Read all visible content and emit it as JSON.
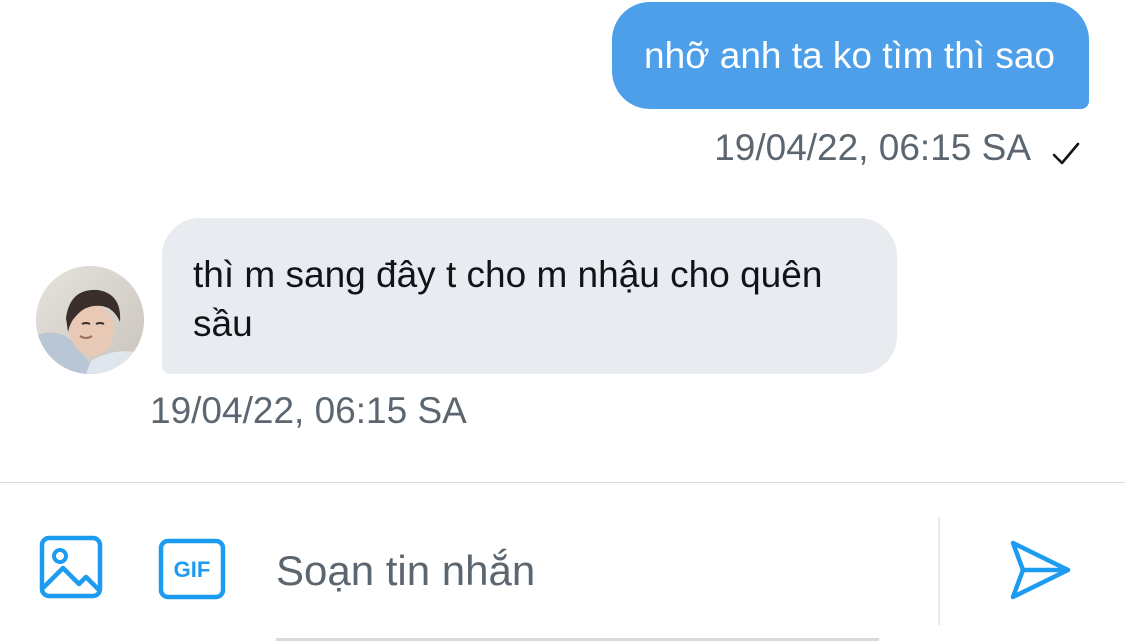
{
  "conversation": {
    "outgoing": {
      "text": "nhỡ anh ta ko tìm thì sao",
      "timestamp": "19/04/22, 06:15 SA",
      "status_icon": "check-icon"
    },
    "incoming": {
      "text": "thì m sang đây t cho m nhậu cho quên sầu",
      "timestamp": "19/04/22, 06:15 SA",
      "avatar_icon": "avatar"
    }
  },
  "composer": {
    "placeholder": "Soạn tin nhắn",
    "value": "",
    "image_icon": "image-icon",
    "gif_label": "GIF",
    "send_icon": "send-icon"
  },
  "colors": {
    "accent": "#1d9bf0",
    "outgoing_bubble": "#4d9fe9",
    "incoming_bubble": "#e8ecf0",
    "secondary_text": "#5b6670"
  }
}
